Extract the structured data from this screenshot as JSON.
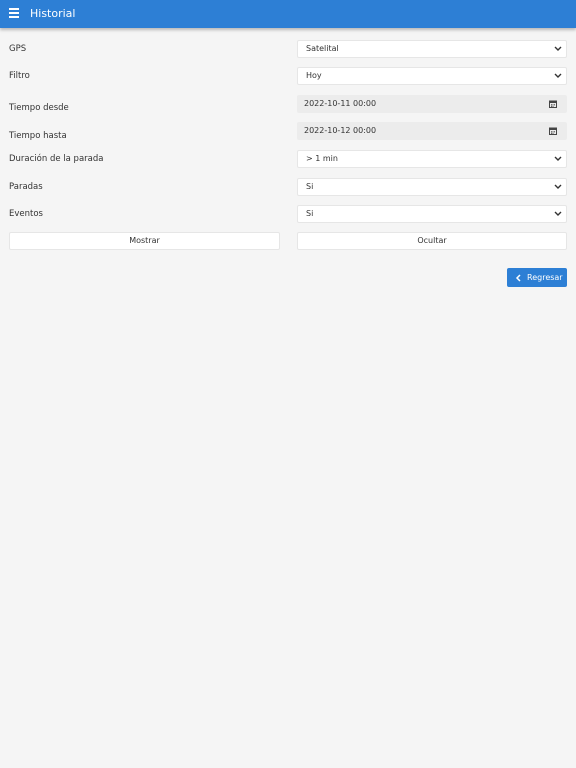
{
  "header": {
    "title": "Historial"
  },
  "form": {
    "gps": {
      "label": "GPS",
      "value": "Satelital"
    },
    "filtro": {
      "label": "Filtro",
      "value": "Hoy"
    },
    "tiempo_desde": {
      "label": "Tiempo desde",
      "value": "2022-10-11 00:00"
    },
    "tiempo_hasta": {
      "label": "Tiempo hasta",
      "value": "2022-10-12 00:00"
    },
    "duracion": {
      "label": "Duración de la parada",
      "value": "> 1 min"
    },
    "paradas": {
      "label": "Paradas",
      "value": "Si"
    },
    "eventos": {
      "label": "Eventos",
      "value": "Si"
    }
  },
  "actions": {
    "mostrar": "Mostrar",
    "ocultar": "Ocultar",
    "regresar": "Regresar"
  },
  "icons": {
    "menu": "menu-icon",
    "dropdown": "chevron-down-icon",
    "calendar": "calendar-icon",
    "back": "chevron-left-icon"
  },
  "colors": {
    "primary": "#2d7fd5",
    "background": "#f5f5f5",
    "field_bg": "#ffffff",
    "date_field_bg": "#ececec"
  }
}
